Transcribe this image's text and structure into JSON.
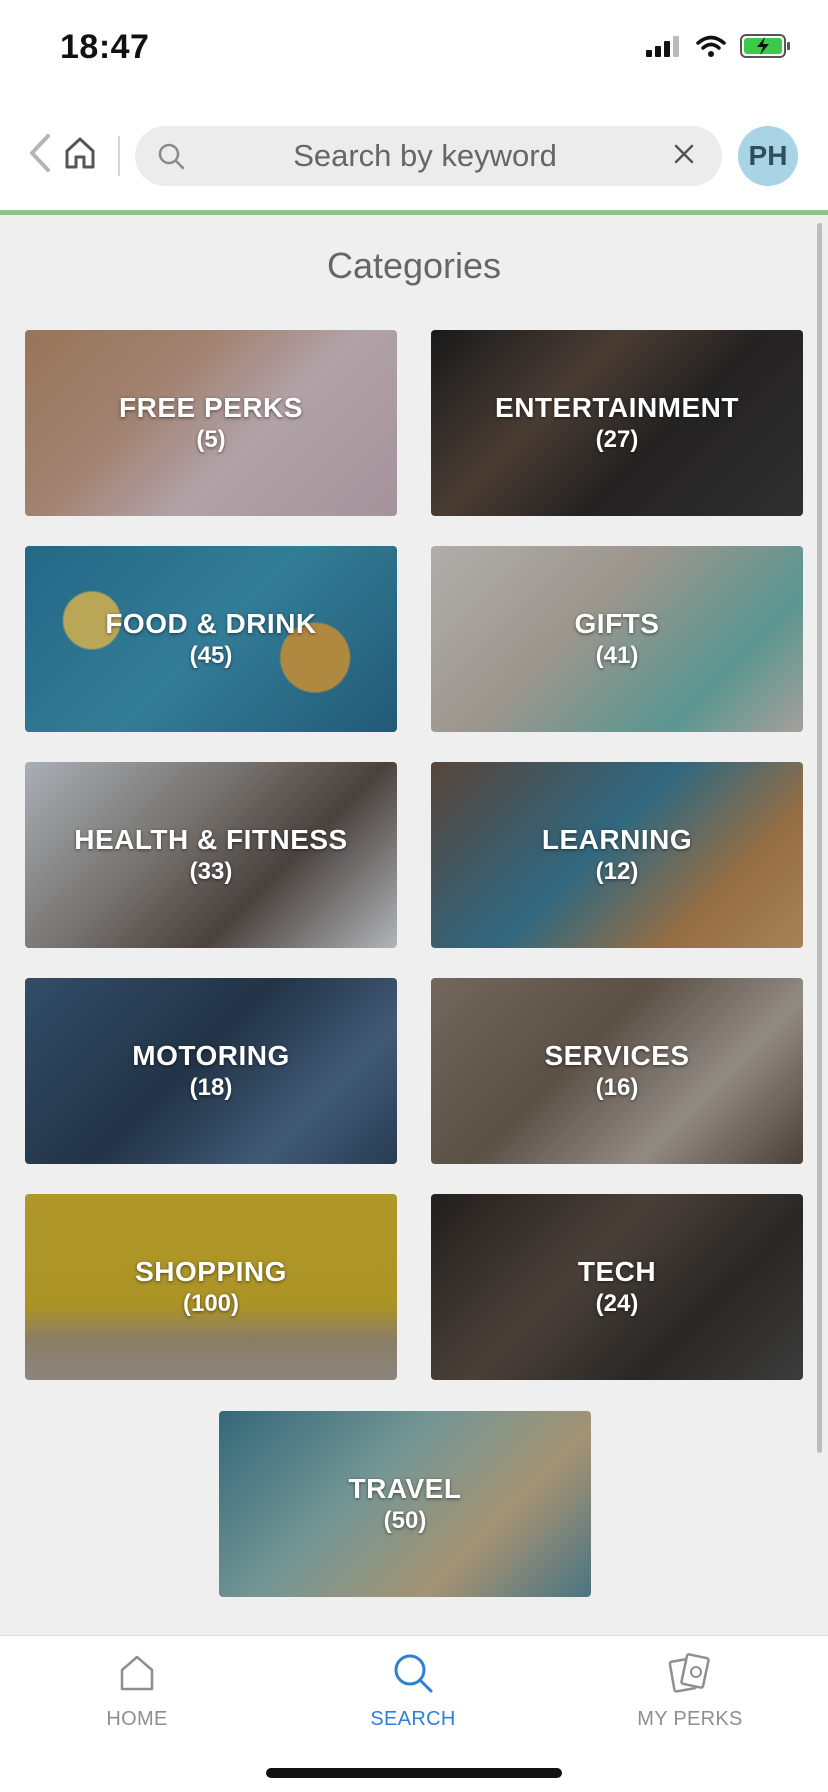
{
  "status_bar": {
    "time": "18:47"
  },
  "header": {
    "search_placeholder": "Search by keyword",
    "avatar_initials": "PH"
  },
  "page": {
    "title": "Categories"
  },
  "categories": [
    {
      "name": "FREE PERKS",
      "count": "(5)"
    },
    {
      "name": "ENTERTAINMENT",
      "count": "(27)"
    },
    {
      "name": "FOOD & DRINK",
      "count": "(45)"
    },
    {
      "name": "GIFTS",
      "count": "(41)"
    },
    {
      "name": "HEALTH & FITNESS",
      "count": "(33)"
    },
    {
      "name": "LEARNING",
      "count": "(12)"
    },
    {
      "name": "MOTORING",
      "count": "(18)"
    },
    {
      "name": "SERVICES",
      "count": "(16)"
    },
    {
      "name": "SHOPPING",
      "count": "(100)"
    },
    {
      "name": "TECH",
      "count": "(24)"
    },
    {
      "name": "TRAVEL",
      "count": "(50)"
    }
  ],
  "bottom_nav": {
    "home_label": "HOME",
    "search_label": "SEARCH",
    "perks_label": "MY PERKS"
  },
  "colors": {
    "accent_line": "#8dc58a",
    "active_nav": "#2f7fd6",
    "inactive_nav": "#8f8f8f",
    "avatar_bg": "#a8d4e6"
  },
  "icons": [
    "signal-icon",
    "wifi-icon",
    "battery-charging-icon",
    "back-chevron-icon",
    "home-icon",
    "search-icon",
    "close-icon",
    "house-icon",
    "magnifier-icon",
    "cards-icon"
  ]
}
